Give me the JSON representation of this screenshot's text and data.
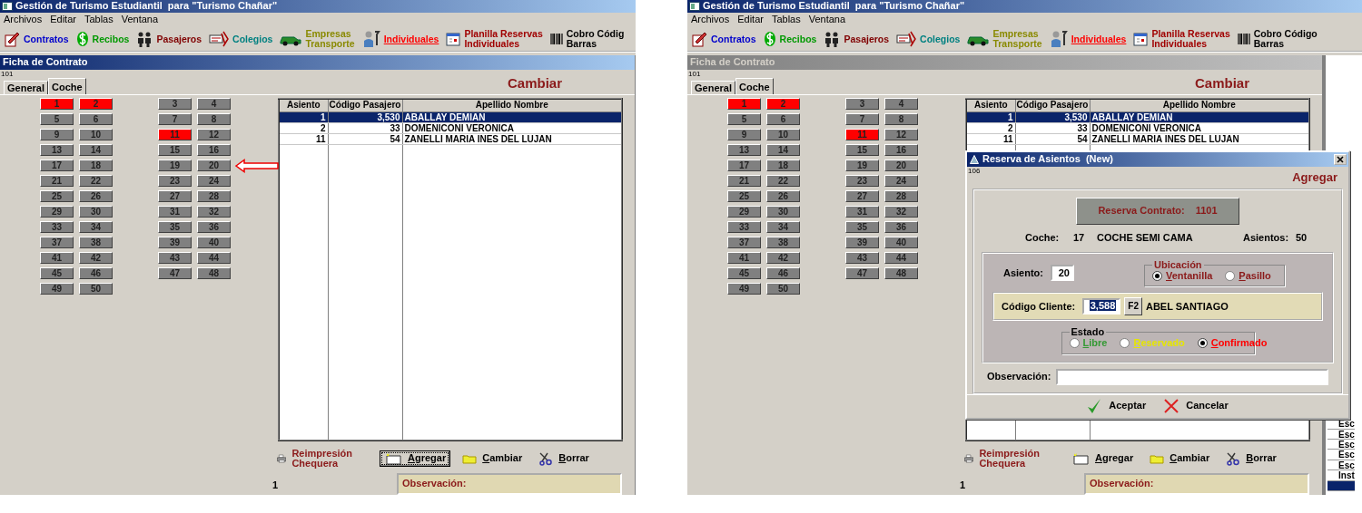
{
  "screens": [
    {
      "app_title": "Gestión de Turismo Estudiantil  para \"Turismo Chañar\"",
      "menu": [
        "Archivos",
        "Editar",
        "Tablas",
        "Ventana"
      ],
      "toolbar": [
        {
          "lines": [
            "Contratos"
          ],
          "color": "#0000cc",
          "hovered": false
        },
        {
          "lines": [
            "Recibos"
          ],
          "color": "#009900",
          "hovered": false
        },
        {
          "lines": [
            "Pasajeros"
          ],
          "color": "#800000",
          "hovered": false
        },
        {
          "lines": [
            "Colegios"
          ],
          "color": "#008080",
          "hovered": false
        },
        {
          "lines": [
            "Empresas",
            "Transporte"
          ],
          "color": "#8a8a00",
          "hovered": false
        },
        {
          "lines": [
            "Individuales"
          ],
          "color": "#ff0000",
          "hovered": true
        },
        {
          "lines": [
            "Planilla Reservas",
            "Individuales"
          ],
          "color": "#a00000",
          "hovered": false
        },
        {
          "lines": [
            "Cobro Códig",
            "Barras"
          ],
          "color": "#000000",
          "hovered": false
        }
      ],
      "form": {
        "title": "Ficha de Contrato",
        "active": true,
        "code": "101",
        "action": "Cambiar",
        "tabs": [
          {
            "label": "General",
            "selected": false
          },
          {
            "label": "Coche",
            "selected": true
          }
        ],
        "seats": [
          {
            "number": "1",
            "occupied": true,
            "pointed": false
          },
          {
            "number": "2",
            "occupied": true,
            "pointed": false
          },
          {
            "number": "3",
            "occupied": false,
            "pointed": false
          },
          {
            "number": "4",
            "occupied": false,
            "pointed": false
          },
          {
            "number": "5",
            "occupied": false,
            "pointed": false
          },
          {
            "number": "6",
            "occupied": false,
            "pointed": false
          },
          {
            "number": "7",
            "occupied": false,
            "pointed": false
          },
          {
            "number": "8",
            "occupied": false,
            "pointed": false
          },
          {
            "number": "9",
            "occupied": false,
            "pointed": false
          },
          {
            "number": "10",
            "occupied": false,
            "pointed": false
          },
          {
            "number": "11",
            "occupied": true,
            "pointed": false
          },
          {
            "number": "12",
            "occupied": false,
            "pointed": false
          },
          {
            "number": "13",
            "occupied": false,
            "pointed": false
          },
          {
            "number": "14",
            "occupied": false,
            "pointed": false
          },
          {
            "number": "15",
            "occupied": false,
            "pointed": false
          },
          {
            "number": "16",
            "occupied": false,
            "pointed": false
          },
          {
            "number": "17",
            "occupied": false,
            "pointed": false
          },
          {
            "number": "18",
            "occupied": false,
            "pointed": false
          },
          {
            "number": "19",
            "occupied": false,
            "pointed": false
          },
          {
            "number": "20",
            "occupied": false,
            "pointed": true
          },
          {
            "number": "21",
            "occupied": false,
            "pointed": false
          },
          {
            "number": "22",
            "occupied": false,
            "pointed": false
          },
          {
            "number": "23",
            "occupied": false,
            "pointed": false
          },
          {
            "number": "24",
            "occupied": false,
            "pointed": false
          },
          {
            "number": "25",
            "occupied": false,
            "pointed": false
          },
          {
            "number": "26",
            "occupied": false,
            "pointed": false
          },
          {
            "number": "27",
            "occupied": false,
            "pointed": false
          },
          {
            "number": "28",
            "occupied": false,
            "pointed": false
          },
          {
            "number": "29",
            "occupied": false,
            "pointed": false
          },
          {
            "number": "30",
            "occupied": false,
            "pointed": false
          },
          {
            "number": "31",
            "occupied": false,
            "pointed": false
          },
          {
            "number": "32",
            "occupied": false,
            "pointed": false
          },
          {
            "number": "33",
            "occupied": false,
            "pointed": false
          },
          {
            "number": "34",
            "occupied": false,
            "pointed": false
          },
          {
            "number": "35",
            "occupied": false,
            "pointed": false
          },
          {
            "number": "36",
            "occupied": false,
            "pointed": false
          },
          {
            "number": "37",
            "occupied": false,
            "pointed": false
          },
          {
            "number": "38",
            "occupied": false,
            "pointed": false
          },
          {
            "number": "39",
            "occupied": false,
            "pointed": false
          },
          {
            "number": "40",
            "occupied": false,
            "pointed": false
          },
          {
            "number": "41",
            "occupied": false,
            "pointed": false
          },
          {
            "number": "42",
            "occupied": false,
            "pointed": false
          },
          {
            "number": "43",
            "occupied": false,
            "pointed": false
          },
          {
            "number": "44",
            "occupied": false,
            "pointed": false
          },
          {
            "number": "45",
            "occupied": false,
            "pointed": false
          },
          {
            "number": "46",
            "occupied": false,
            "pointed": false
          },
          {
            "number": "47",
            "occupied": false,
            "pointed": false
          },
          {
            "number": "48",
            "occupied": false,
            "pointed": false
          },
          {
            "number": "49",
            "occupied": false,
            "pointed": false
          },
          {
            "number": "50",
            "occupied": false,
            "pointed": false
          }
        ],
        "table": {
          "columns": [
            "Asiento",
            "Código Pasajero",
            "Apellido Nombre"
          ],
          "rows": [
            {
              "cells": [
                "1",
                "3,530",
                "ABALLAY DEMIAN"
              ],
              "selected": true
            },
            {
              "cells": [
                "2",
                "33",
                "DOMENICONI VERONICA"
              ],
              "selected": false
            },
            {
              "cells": [
                "11",
                "54",
                "ZANELLI MARIA INES DEL LUJAN"
              ],
              "selected": false
            }
          ]
        },
        "actions": [
          {
            "kind": "print",
            "label": "Reimpresión Chequera",
            "focused": false
          },
          {
            "kind": "add",
            "label": "Agregar",
            "focused": true
          },
          {
            "kind": "edit",
            "label": "Cambiar",
            "focused": false
          },
          {
            "kind": "delete",
            "label": "Borrar",
            "focused": false
          }
        ],
        "page": "1",
        "observation_label": "Observación:"
      }
    },
    {
      "app_title": "Gestión de Turismo Estudiantil  para \"Turismo Chañar\"",
      "menu": [
        "Archivos",
        "Editar",
        "Tablas",
        "Ventana"
      ],
      "toolbar": [
        {
          "lines": [
            "Contratos"
          ],
          "color": "#0000cc",
          "hovered": false
        },
        {
          "lines": [
            "Recibos"
          ],
          "color": "#009900",
          "hovered": false
        },
        {
          "lines": [
            "Pasajeros"
          ],
          "color": "#800000",
          "hovered": false
        },
        {
          "lines": [
            "Colegios"
          ],
          "color": "#008080",
          "hovered": false
        },
        {
          "lines": [
            "Empresas",
            "Transporte"
          ],
          "color": "#8a8a00",
          "hovered": false
        },
        {
          "lines": [
            "Individuales"
          ],
          "color": "#ff0000",
          "hovered": true
        },
        {
          "lines": [
            "Planilla Reservas",
            "Individuales"
          ],
          "color": "#a00000",
          "hovered": false
        },
        {
          "lines": [
            "Cobro Código",
            "Barras"
          ],
          "color": "#000000",
          "hovered": false
        }
      ],
      "form": {
        "title": "Ficha de Contrato",
        "active": false,
        "code": "101",
        "action": "Cambiar",
        "tabs": [
          {
            "label": "General",
            "selected": false
          },
          {
            "label": "Coche",
            "selected": true
          }
        ],
        "seats": [
          {
            "number": "1",
            "occupied": true,
            "pointed": false
          },
          {
            "number": "2",
            "occupied": true,
            "pointed": false
          },
          {
            "number": "3",
            "occupied": false,
            "pointed": false
          },
          {
            "number": "4",
            "occupied": false,
            "pointed": false
          },
          {
            "number": "5",
            "occupied": false,
            "pointed": false
          },
          {
            "number": "6",
            "occupied": false,
            "pointed": false
          },
          {
            "number": "7",
            "occupied": false,
            "pointed": false
          },
          {
            "number": "8",
            "occupied": false,
            "pointed": false
          },
          {
            "number": "9",
            "occupied": false,
            "pointed": false
          },
          {
            "number": "10",
            "occupied": false,
            "pointed": false
          },
          {
            "number": "11",
            "occupied": true,
            "pointed": false
          },
          {
            "number": "12",
            "occupied": false,
            "pointed": false
          },
          {
            "number": "13",
            "occupied": false,
            "pointed": false
          },
          {
            "number": "14",
            "occupied": false,
            "pointed": false
          },
          {
            "number": "15",
            "occupied": false,
            "pointed": false
          },
          {
            "number": "16",
            "occupied": false,
            "pointed": false
          },
          {
            "number": "17",
            "occupied": false,
            "pointed": false
          },
          {
            "number": "18",
            "occupied": false,
            "pointed": false
          },
          {
            "number": "19",
            "occupied": false,
            "pointed": false
          },
          {
            "number": "20",
            "occupied": false,
            "pointed": false
          },
          {
            "number": "21",
            "occupied": false,
            "pointed": false
          },
          {
            "number": "22",
            "occupied": false,
            "pointed": false
          },
          {
            "number": "23",
            "occupied": false,
            "pointed": false
          },
          {
            "number": "24",
            "occupied": false,
            "pointed": false
          },
          {
            "number": "25",
            "occupied": false,
            "pointed": false
          },
          {
            "number": "26",
            "occupied": false,
            "pointed": false
          },
          {
            "number": "27",
            "occupied": false,
            "pointed": false
          },
          {
            "number": "28",
            "occupied": false,
            "pointed": false
          },
          {
            "number": "29",
            "occupied": false,
            "pointed": false
          },
          {
            "number": "30",
            "occupied": false,
            "pointed": false
          },
          {
            "number": "31",
            "occupied": false,
            "pointed": false
          },
          {
            "number": "32",
            "occupied": false,
            "pointed": false
          },
          {
            "number": "33",
            "occupied": false,
            "pointed": false
          },
          {
            "number": "34",
            "occupied": false,
            "pointed": false
          },
          {
            "number": "35",
            "occupied": false,
            "pointed": false
          },
          {
            "number": "36",
            "occupied": false,
            "pointed": false
          },
          {
            "number": "37",
            "occupied": false,
            "pointed": false
          },
          {
            "number": "38",
            "occupied": false,
            "pointed": false
          },
          {
            "number": "39",
            "occupied": false,
            "pointed": false
          },
          {
            "number": "40",
            "occupied": false,
            "pointed": false
          },
          {
            "number": "41",
            "occupied": false,
            "pointed": false
          },
          {
            "number": "42",
            "occupied": false,
            "pointed": false
          },
          {
            "number": "43",
            "occupied": false,
            "pointed": false
          },
          {
            "number": "44",
            "occupied": false,
            "pointed": false
          },
          {
            "number": "45",
            "occupied": false,
            "pointed": false
          },
          {
            "number": "46",
            "occupied": false,
            "pointed": false
          },
          {
            "number": "47",
            "occupied": false,
            "pointed": false
          },
          {
            "number": "48",
            "occupied": false,
            "pointed": false
          },
          {
            "number": "49",
            "occupied": false,
            "pointed": false
          },
          {
            "number": "50",
            "occupied": false,
            "pointed": false
          }
        ],
        "table": {
          "columns": [
            "Asiento",
            "Código Pasajero",
            "Apellido Nombre"
          ],
          "rows": [
            {
              "cells": [
                "1",
                "3,530",
                "ABALLAY DEMIAN"
              ],
              "selected": true
            },
            {
              "cells": [
                "2",
                "33",
                "DOMENICONI VERONICA"
              ],
              "selected": false
            },
            {
              "cells": [
                "11",
                "54",
                "ZANELLI MARIA INES DEL LUJAN"
              ],
              "selected": false
            }
          ]
        },
        "actions": [
          {
            "kind": "print",
            "label": "Reimpresión Chequera",
            "focused": false
          },
          {
            "kind": "add",
            "label": "Agregar",
            "focused": false
          },
          {
            "kind": "edit",
            "label": "Cambiar",
            "focused": false
          },
          {
            "kind": "delete",
            "label": "Borrar",
            "focused": false
          }
        ],
        "page": "1",
        "observation_label": "Observación:"
      },
      "dialog": {
        "title": "Reserva de Asientos  (New)",
        "code": "106",
        "action": "Agregar",
        "contract": {
          "label": "Reserva Contrato:",
          "value": "1101"
        },
        "coach": {
          "label": "Coche:",
          "number": "17",
          "name": "COCHE SEMI CAMA",
          "seats_label": "Asientos:",
          "seats": "50"
        },
        "seat": {
          "label": "Asiento:",
          "value": "20"
        },
        "location": {
          "legend": "Ubicación",
          "options": [
            {
              "label": "Ventanilla",
              "selected": true
            },
            {
              "label": "Pasillo",
              "selected": false
            }
          ]
        },
        "client": {
          "label": "Código Cliente:",
          "value": "3,588",
          "value_selected": true,
          "lookup": "F2",
          "name": "ABEL SANTIAGO"
        },
        "status": {
          "legend": "Estado",
          "options": [
            {
              "label": "Libre",
              "color": "#339933",
              "selected": false
            },
            {
              "label": "Reservado",
              "color": "#e6e600",
              "selected": false
            },
            {
              "label": "Confirmado",
              "color": "#ff0000",
              "selected": true
            }
          ]
        },
        "observation": {
          "label": "Observación:"
        },
        "buttons": [
          {
            "kind": "ok",
            "label": "Aceptar"
          },
          {
            "kind": "cancel",
            "label": "Cancelar"
          }
        ]
      },
      "side_list": [
        {
          "text": "Esc",
          "selected": false
        },
        {
          "text": "Esc",
          "selected": false
        },
        {
          "text": "Esc",
          "selected": false
        },
        {
          "text": "Esc",
          "selected": false
        },
        {
          "text": "Esc",
          "selected": false
        },
        {
          "text": "Inst",
          "selected": false
        },
        {
          "selected": true
        }
      ]
    }
  ]
}
